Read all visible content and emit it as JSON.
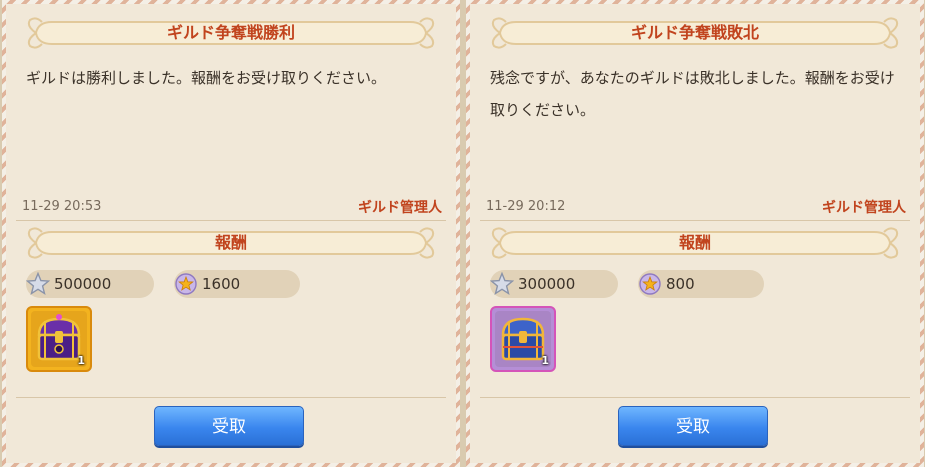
{
  "panels": [
    {
      "title": "ギルド争奪戦勝利",
      "message": "ギルドは勝利しました。報酬をお受け取りください。",
      "timestamp": "11-29 20:53",
      "sender": "ギルド管理人",
      "reward_header": "報酬",
      "rewards": [
        {
          "icon": "silver-star-icon",
          "amount": "500000"
        },
        {
          "icon": "gold-medal-icon",
          "amount": "1600"
        }
      ],
      "item": {
        "icon": "purple-treasure-chest-icon",
        "count": "1"
      },
      "claim_label": "受取"
    },
    {
      "title": "ギルド争奪戦敗北",
      "message": "残念ですが、あなたのギルドは敗北しました。報酬をお受け取りください。",
      "timestamp": "11-29 20:12",
      "sender": "ギルド管理人",
      "reward_header": "報酬",
      "rewards": [
        {
          "icon": "silver-star-icon",
          "amount": "300000"
        },
        {
          "icon": "gold-medal-icon",
          "amount": "800"
        }
      ],
      "item": {
        "icon": "blue-treasure-chest-icon",
        "count": "1"
      },
      "claim_label": "受取"
    }
  ],
  "colors": {
    "accent_text": "#c1441e",
    "button_blue": "#3a86ee",
    "panel_bg": "#f1e8d8"
  }
}
